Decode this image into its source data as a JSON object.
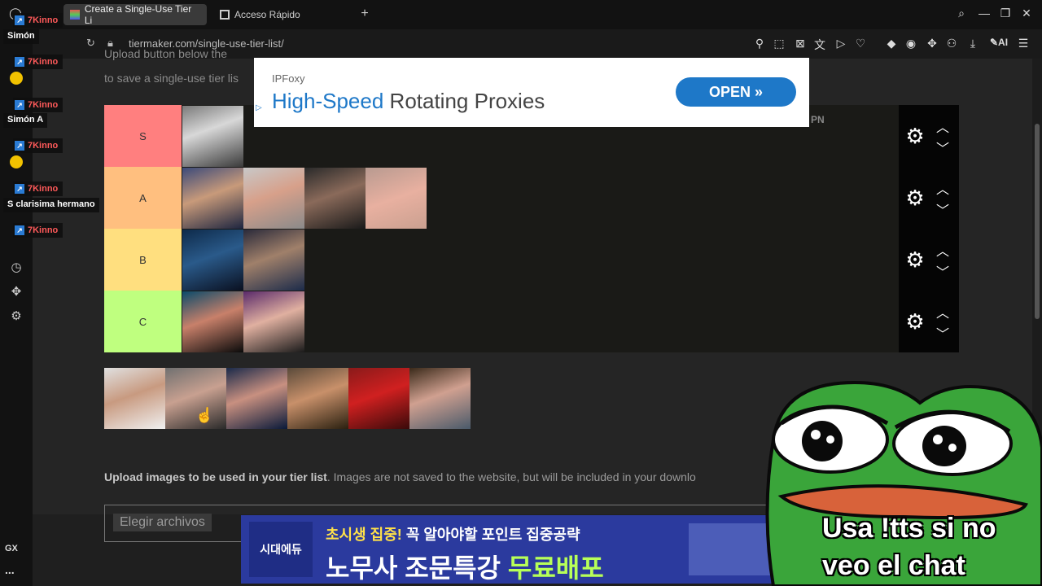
{
  "browser": {
    "tabs": [
      {
        "label": "Create a Single-Use Tier Li",
        "active": true
      },
      {
        "label": "Acceso Rápido",
        "active": false
      }
    ],
    "url": "tiermaker.com/single-use-tier-list/"
  },
  "sidebar": {
    "bottom_label": "GX",
    "more_label": "..."
  },
  "chat": {
    "username": "7Kinno",
    "messages": [
      "Simón",
      "Simón A",
      "S clarisima hermano"
    ]
  },
  "page": {
    "intro_line1": "Upload button below the",
    "intro_line2": "to save a single-use tier lis",
    "upload_title": "Upload images to be used in your tier list",
    "upload_desc": ". Images are not saved to the website, but will be included in your downlo",
    "file_button": "Elegir archivos"
  },
  "tiers": [
    {
      "label": "S",
      "color": "#ff7f7f"
    },
    {
      "label": "A",
      "color": "#ffbf7f"
    },
    {
      "label": "B",
      "color": "#ffdf7f"
    },
    {
      "label": "C",
      "color": "#bfff7f"
    }
  ],
  "ad_top": {
    "brand": "IPFoxy",
    "headline_highlight": "High-Speed",
    "headline_rest": " Rotating Proxies",
    "cta": "OPEN",
    "overlapped_text": "PN"
  },
  "ad_bottom": {
    "logo": "시대에듀",
    "line1_a": "초시생 집중!",
    "line1_b": " 꼭 알아야할 포인트 집중공략",
    "line2_a": "노무사 조문특강 ",
    "line2_b": "무료배포"
  },
  "overlay": {
    "line1": "Usa !tts si no",
    "line2": "veo el chat"
  },
  "colors": {
    "tier_ctrl_bg": "#050505",
    "ad_blue": "#1e78c8",
    "pepe_green": "#3aa53a"
  }
}
